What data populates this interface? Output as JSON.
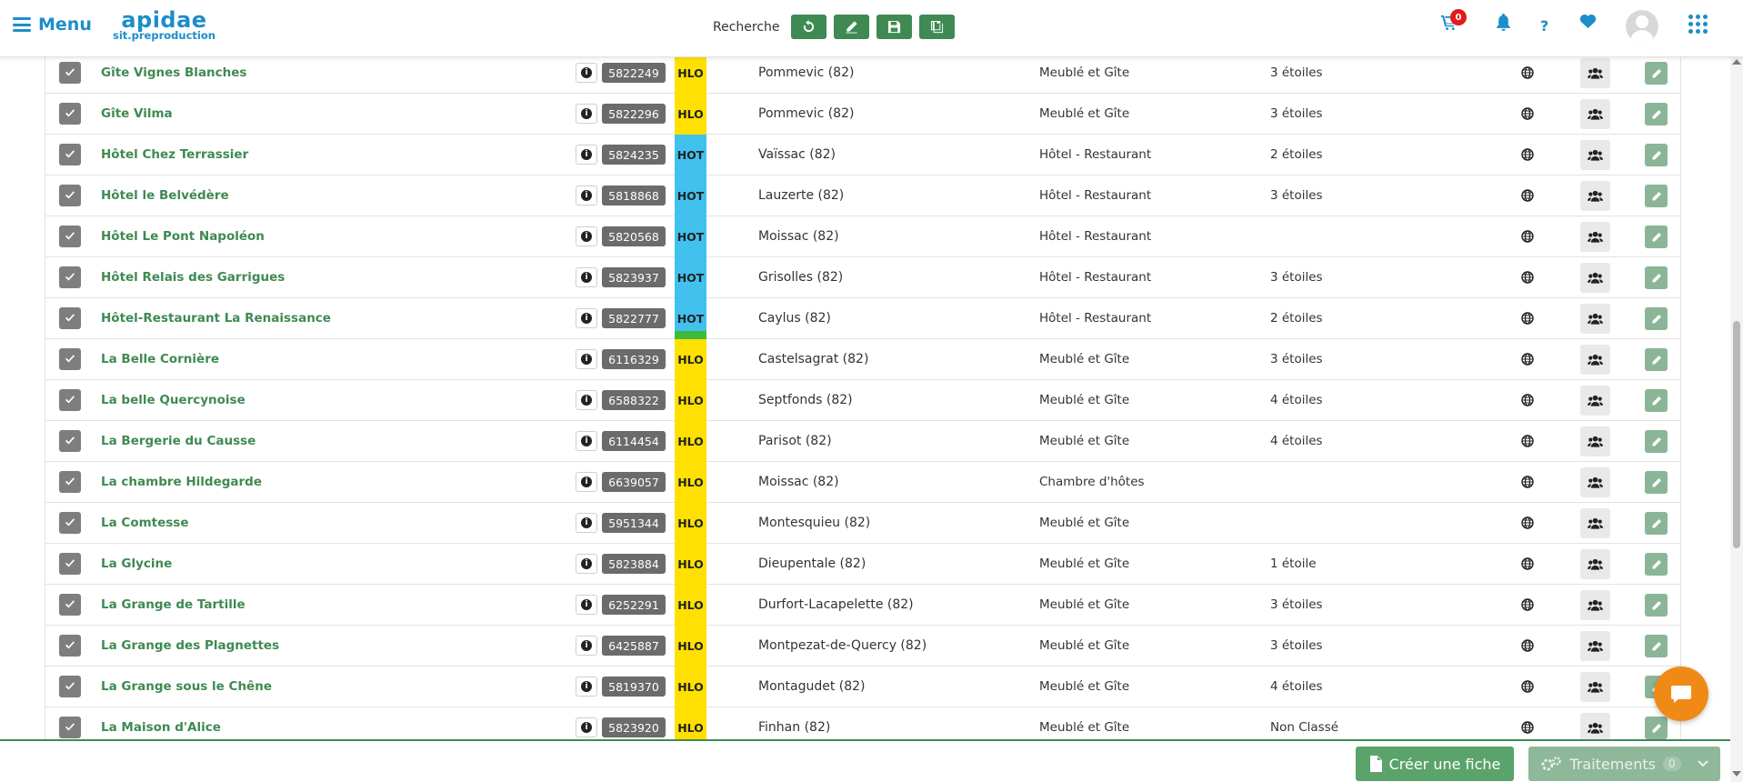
{
  "header": {
    "menu_label": "Menu",
    "logo_main": "apidae",
    "logo_sub": "sit.preproduction",
    "search_label": "Recherche",
    "cart_count": "0",
    "help_label": "?"
  },
  "rows": [
    {
      "name": "Gîte Vignes Blanches",
      "id": "5822249",
      "type": "HLO",
      "type_color": "#ffe000",
      "city": "Pommevic (82)",
      "category": "Meublé et Gîte",
      "stars": "3 étoiles"
    },
    {
      "name": "Gîte Vilma",
      "id": "5822296",
      "type": "HLO",
      "type_color": "#ffe000",
      "city": "Pommevic (82)",
      "category": "Meublé et Gîte",
      "stars": "3 étoiles"
    },
    {
      "name": "Hôtel Chez Terrassier",
      "id": "5824235",
      "type": "HOT",
      "type_color": "#40c1ee",
      "city": "Vaïssac (82)",
      "category": "Hôtel - Restaurant",
      "stars": "2 étoiles"
    },
    {
      "name": "Hôtel le Belvédère",
      "id": "5818868",
      "type": "HOT",
      "type_color": "#40c1ee",
      "city": "Lauzerte (82)",
      "category": "Hôtel - Restaurant",
      "stars": "3 étoiles"
    },
    {
      "name": "Hôtel Le Pont Napoléon",
      "id": "5820568",
      "type": "HOT",
      "type_color": "#40c1ee",
      "city": "Moissac (82)",
      "category": "Hôtel - Restaurant",
      "stars": ""
    },
    {
      "name": "Hôtel Relais des Garrigues",
      "id": "5823937",
      "type": "HOT",
      "type_color": "#40c1ee",
      "city": "Grisolles (82)",
      "category": "Hôtel - Restaurant",
      "stars": "3 étoiles"
    },
    {
      "name": "Hôtel-Restaurant La Renaissance",
      "id": "5822777",
      "type": "HOT",
      "type_color": "#40c1ee",
      "city": "Caylus (82)",
      "category": "Hôtel - Restaurant",
      "stars": "2 étoiles"
    },
    {
      "name": "La Belle Cornière",
      "id": "6116329",
      "type": "HLO",
      "type_color": "#ffe000",
      "city": "Castelsagrat (82)",
      "category": "Meublé et Gîte",
      "stars": "3 étoiles"
    },
    {
      "name": "La belle Quercynoise",
      "id": "6588322",
      "type": "HLO",
      "type_color": "#ffe000",
      "city": "Septfonds (82)",
      "category": "Meublé et Gîte",
      "stars": "4 étoiles"
    },
    {
      "name": "La Bergerie du Causse",
      "id": "6114454",
      "type": "HLO",
      "type_color": "#ffe000",
      "city": "Parisot (82)",
      "category": "Meublé et Gîte",
      "stars": "4 étoiles"
    },
    {
      "name": "La chambre Hildegarde",
      "id": "6639057",
      "type": "HLO",
      "type_color": "#ffe000",
      "city": "Moissac (82)",
      "category": "Chambre d'hôtes",
      "stars": ""
    },
    {
      "name": "La Comtesse",
      "id": "5951344",
      "type": "HLO",
      "type_color": "#ffe000",
      "city": "Montesquieu (82)",
      "category": "Meublé et Gîte",
      "stars": ""
    },
    {
      "name": "La Glycine",
      "id": "5823884",
      "type": "HLO",
      "type_color": "#ffe000",
      "city": "Dieupentale (82)",
      "category": "Meublé et Gîte",
      "stars": "1 étoile"
    },
    {
      "name": "La Grange de Tartille",
      "id": "6252291",
      "type": "HLO",
      "type_color": "#ffe000",
      "city": "Durfort-Lacapelette (82)",
      "category": "Meublé et Gîte",
      "stars": "3 étoiles"
    },
    {
      "name": "La Grange des Plagnettes",
      "id": "6425887",
      "type": "HLO",
      "type_color": "#ffe000",
      "city": "Montpezat-de-Quercy (82)",
      "category": "Meublé et Gîte",
      "stars": "3 étoiles"
    },
    {
      "name": "La Grange sous le Chêne",
      "id": "5819370",
      "type": "HLO",
      "type_color": "#ffe000",
      "city": "Montagudet (82)",
      "category": "Meublé et Gîte",
      "stars": "4 étoiles"
    },
    {
      "name": "La Maison d'Alice",
      "id": "5823920",
      "type": "HLO",
      "type_color": "#ffe000",
      "city": "Finhan (82)",
      "category": "Meublé et Gîte",
      "stars": "Non Classé"
    }
  ],
  "footer": {
    "create_label": "Créer une fiche",
    "treatments_label": "Traitements",
    "treatments_count": "0"
  },
  "icons": {
    "menu": "hamburger-icon",
    "undo": "undo-icon",
    "edit": "pencil-icon",
    "save": "save-icon",
    "copy": "copy-icon",
    "cart": "cart-icon",
    "bell": "bell-icon",
    "heart": "heart-icon",
    "apps": "grid-icon",
    "globe": "globe-icon",
    "people": "users-icon",
    "chat": "chat-icon"
  },
  "colors": {
    "brand_blue": "#1c8ec9",
    "green": "#3f8a52",
    "hlo": "#ffe000",
    "hot": "#40c1ee",
    "chat": "#f08a16"
  }
}
